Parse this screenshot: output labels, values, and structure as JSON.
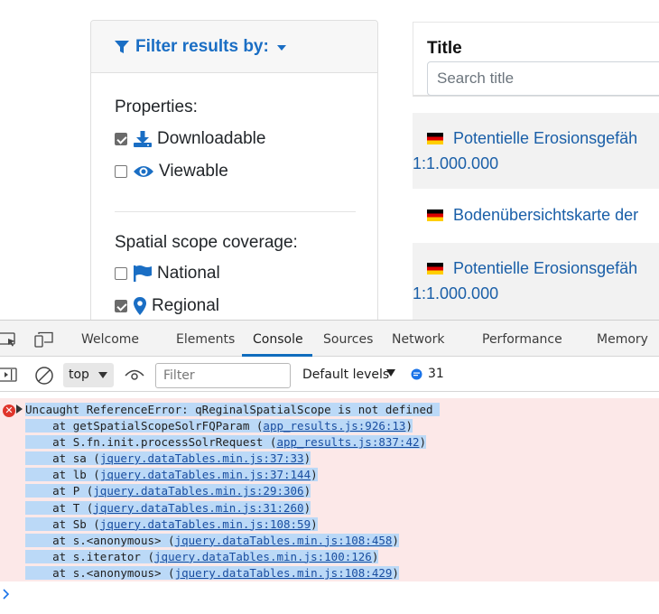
{
  "filter": {
    "title": "Filter results by:",
    "properties_label": "Properties:",
    "properties": [
      {
        "label": "Downloadable",
        "checked": true,
        "icon": "download-icon"
      },
      {
        "label": "Viewable",
        "checked": false,
        "icon": "eye-icon"
      }
    ],
    "spatial_label": "Spatial scope coverage:",
    "spatial": [
      {
        "label": "National",
        "checked": false,
        "icon": "flag-icon"
      },
      {
        "label": "Regional",
        "checked": true,
        "icon": "map-marker-icon"
      }
    ]
  },
  "results": {
    "title_header": "Title",
    "search_placeholder": "Search title",
    "rows": [
      {
        "title": "Potentielle Erosionsgefäh",
        "scale": "1:1.000.000"
      },
      {
        "title": "Bodenübersichtskarte der",
        "scale": ""
      },
      {
        "title": "Potentielle Erosionsgefäh",
        "scale": "1:1.000.000"
      }
    ]
  },
  "devtools": {
    "tabs": [
      "Welcome",
      "Elements",
      "Console",
      "Sources",
      "Network",
      "Performance",
      "Memory"
    ],
    "active_tab": "Console",
    "context": "top",
    "filter_placeholder": "Filter",
    "levels": "Default levels",
    "issues_count": "31",
    "error": {
      "message": "Uncaught ReferenceError: qReginalSpatialScope is not defined",
      "stack": [
        {
          "fn": "getSpatialScopeSolrFQParam",
          "loc": "app_results.js:926:13"
        },
        {
          "fn": "S.fn.init.processSolrRequest",
          "loc": "app_results.js:837:42"
        },
        {
          "fn": "sa",
          "loc": "jquery.dataTables.min.js:37:33"
        },
        {
          "fn": "lb",
          "loc": "jquery.dataTables.min.js:37:144"
        },
        {
          "fn": "P",
          "loc": "jquery.dataTables.min.js:29:306"
        },
        {
          "fn": "T",
          "loc": "jquery.dataTables.min.js:31:260"
        },
        {
          "fn": "Sb",
          "loc": "jquery.dataTables.min.js:108:59"
        },
        {
          "fn": "s.<anonymous>",
          "loc": "jquery.dataTables.min.js:108:458"
        },
        {
          "fn": "s.iterator",
          "loc": "jquery.dataTables.min.js:100:126"
        },
        {
          "fn": "s.<anonymous>",
          "loc": "jquery.dataTables.min.js:108:429"
        }
      ]
    }
  },
  "colors": {
    "link": "#1a5fa8",
    "accent": "#1a6ec4",
    "error_bg": "#fce8e8",
    "selection": "#bbd9f7"
  }
}
